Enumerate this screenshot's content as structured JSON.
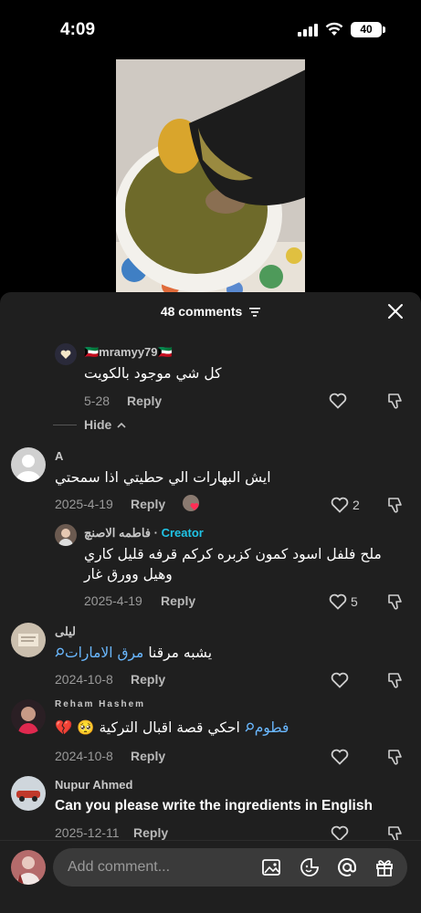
{
  "status_bar": {
    "time": "4:09",
    "battery": "40"
  },
  "sheet": {
    "title": "48 comments",
    "hide_label": "Hide"
  },
  "comments": [
    {
      "username": "🇰🇼mramyy79🇰🇼",
      "text": "كل شي موجود بالكويت",
      "date": "5-28",
      "reply_label": "Reply"
    },
    {
      "username": "A",
      "text": "ايش البهارات الي حطيتي اذا سمحتي",
      "date": "2025-4-19",
      "reply_label": "Reply",
      "likes": "2"
    },
    {
      "username": "فاطمه الاصنچ",
      "creator_label": "Creator",
      "text": "ملح فلفل اسود كمون كزبره كركم قرفه قليل كاري وهيل وورق غار",
      "date": "2025-4-19",
      "reply_label": "Reply",
      "likes": "5"
    },
    {
      "username": "ليلى",
      "text_prefix": "يشبه مرقنا",
      "text_link": "مرق الامارات",
      "date": "2024-10-8",
      "reply_label": "Reply"
    },
    {
      "username": "Reham Hashem",
      "text_link": "فطوم",
      "text_suffix": "احكي قصة اقبال التركية 🥺 💔",
      "date": "2024-10-8",
      "reply_label": "Reply"
    },
    {
      "username": "Nupur Ahmed",
      "text": "Can you please write the ingredients in English",
      "date": "2025-12-11",
      "reply_label": "Reply"
    }
  ],
  "bottom_bar": {
    "placeholder": "Add comment..."
  },
  "colors": {
    "sheet_bg": "#1f1f1f",
    "link": "#6ab8ff",
    "creator": "#20c4e6"
  }
}
